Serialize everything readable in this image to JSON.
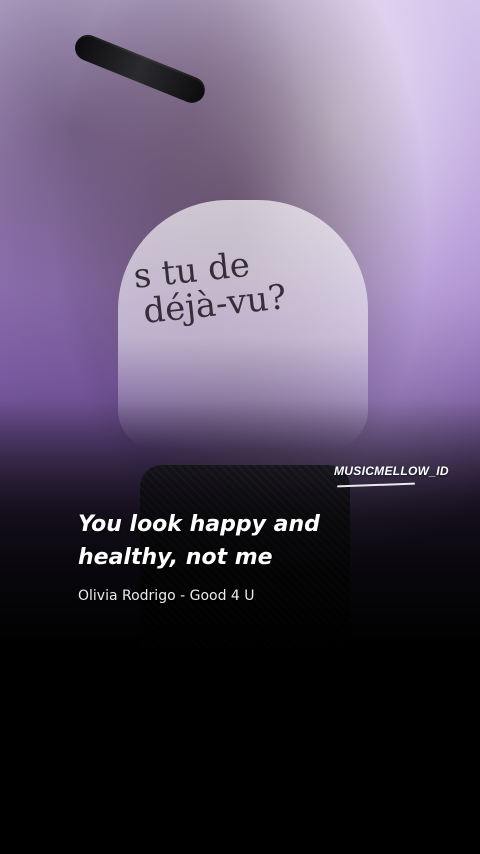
{
  "watermark": {
    "text": "MUSICMELLOW_ID"
  },
  "shirt": {
    "line1": "s tu de",
    "line2": "déjà-vu?"
  },
  "caption": {
    "line1": "You look happy and",
    "line2": "healthy, not me"
  },
  "credit": {
    "text": "Olivia Rodrigo - Good 4 U"
  },
  "colors": {
    "background": "#000000",
    "text_primary": "#ffffff",
    "text_secondary": "#ebebeb",
    "photo_tint": "#b59bd8"
  }
}
